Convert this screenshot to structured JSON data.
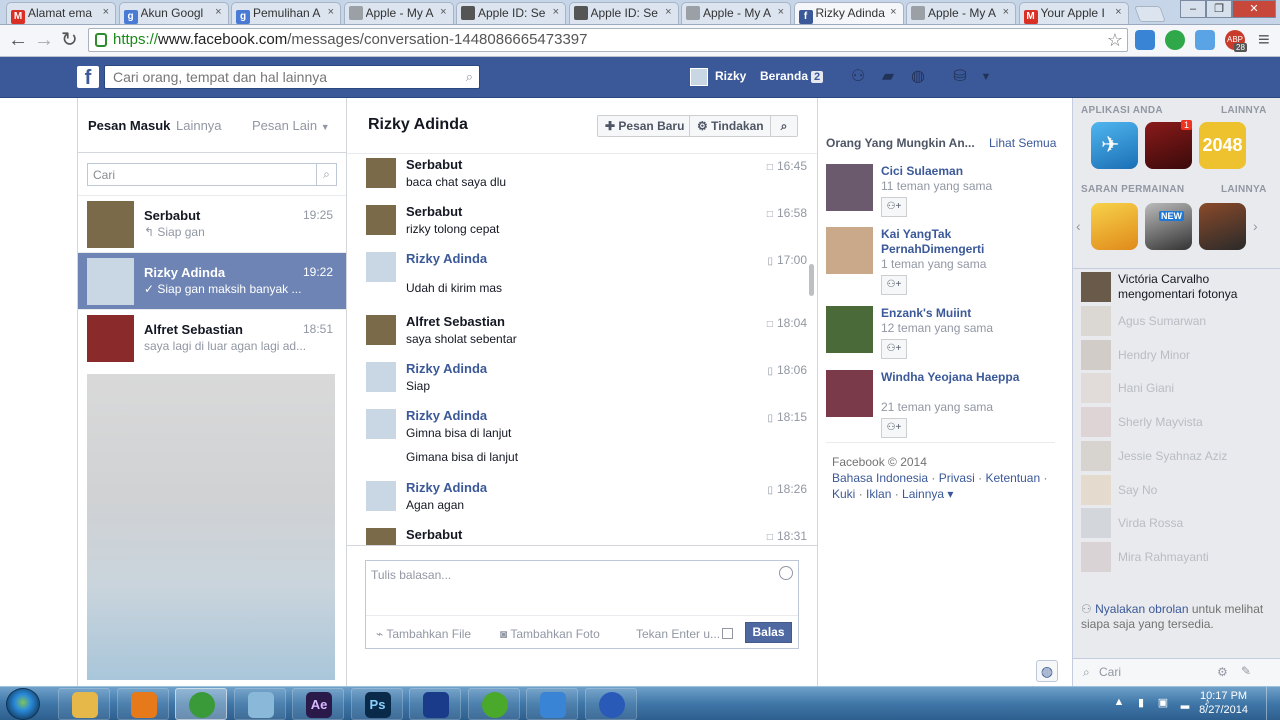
{
  "browser": {
    "tabs": [
      {
        "label": "Alamat ema",
        "favicon": "gmail-icon",
        "color": "#d93025",
        "glyph": "M"
      },
      {
        "label": "Akun Googl",
        "favicon": "google-icon",
        "color": "#4a7bd4",
        "glyph": "g"
      },
      {
        "label": "Pemulihan A",
        "favicon": "google-icon",
        "color": "#4a7bd4",
        "glyph": "g"
      },
      {
        "label": "Apple - My A",
        "favicon": "page-icon",
        "color": "#9aa0a6",
        "glyph": ""
      },
      {
        "label": "Apple ID: Se",
        "favicon": "apple-icon",
        "color": "#555555",
        "glyph": ""
      },
      {
        "label": "Apple ID: Se",
        "favicon": "apple-icon",
        "color": "#555555",
        "glyph": ""
      },
      {
        "label": "Apple - My A",
        "favicon": "page-icon",
        "color": "#9aa0a6",
        "glyph": ""
      },
      {
        "label": "Rizky Adinda",
        "favicon": "facebook-icon",
        "color": "#3b5998",
        "glyph": "f",
        "active": true
      },
      {
        "label": "Apple - My A",
        "favicon": "page-icon",
        "color": "#9aa0a6",
        "glyph": ""
      },
      {
        "label": "Your Apple I",
        "favicon": "gmail-icon",
        "color": "#d93025",
        "glyph": "M"
      }
    ],
    "url_scheme": "https://",
    "url_domain": "www.facebook.com",
    "url_path": "/messages/conversation-1448086665473397",
    "adblock_badge": "28"
  },
  "fb": {
    "search_placeholder": "Cari orang, tempat dan hal lainnya",
    "user_name": "Rizky",
    "home_label": "Beranda",
    "home_count": "2"
  },
  "inbox": {
    "tab_inbox": "Pesan Masuk",
    "tab_more": "Lainnya",
    "tab_other": "Pesan Lain",
    "search_placeholder": "Cari",
    "threads": [
      {
        "name": "Serbabut",
        "time": "19:25",
        "snippet": "↰ Siap gan",
        "selected": false,
        "avatar": "#7a6a4a"
      },
      {
        "name": "Rizky Adinda",
        "time": "19:22",
        "snippet": "✓ Siap gan maksih banyak ...",
        "selected": true,
        "avatar": "#c9d6e4"
      },
      {
        "name": "Alfret Sebastian",
        "time": "18:51",
        "snippet": "saya lagi di luar agan lagi ad...",
        "selected": false,
        "avatar": "#8a2a2a"
      }
    ]
  },
  "conversation": {
    "title": "Rizky Adinda",
    "new_message_label": "Pesan Baru",
    "actions_label": "Tindakan",
    "messages": [
      {
        "author": "Serbabut",
        "text": "baca chat saya dlu",
        "time": "16:45",
        "me": false,
        "device": "□"
      },
      {
        "author": "Serbabut",
        "text": "rizky tolong cepat",
        "time": "16:58",
        "me": false,
        "device": "□"
      },
      {
        "author": "Rizky Adinda",
        "text": "Udah di kirim mas",
        "time": "17:00",
        "me": true,
        "device": "▯"
      },
      {
        "author": "Alfret Sebastian",
        "text": "saya sholat sebentar",
        "time": "18:04",
        "me": false,
        "device": "□"
      },
      {
        "author": "Rizky Adinda",
        "text": "Siap",
        "time": "18:06",
        "me": true,
        "device": "▯"
      },
      {
        "author": "Rizky Adinda",
        "text": "Gimna bisa di lanjut",
        "time": "18:15",
        "me": true,
        "device": "▯"
      },
      {
        "author": "",
        "text": "Gimana bisa di lanjut",
        "time": "",
        "me": true,
        "device": ""
      },
      {
        "author": "Rizky Adinda",
        "text": "Agan agan",
        "time": "18:26",
        "me": true,
        "device": "▯"
      },
      {
        "author": "Serbabut",
        "text": "",
        "time": "18:31",
        "me": false,
        "device": "□"
      }
    ],
    "composer_placeholder": "Tulis balasan...",
    "add_file_label": "Tambahkan File",
    "add_photo_label": "Tambahkan Foto",
    "press_enter_label": "Tekan Enter u...",
    "reply_label": "Balas"
  },
  "pymk": {
    "title": "Orang Yang Mungkin An...",
    "see_all": "Lihat Semua",
    "people": [
      {
        "name": "Cici Sulaeman",
        "mutual": "11 teman yang sama",
        "photo": "#6b5a6e"
      },
      {
        "name": "Kai YangTak PernahDimengerti",
        "mutual": "1 teman yang sama",
        "photo": "#c9a98a"
      },
      {
        "name": "Enzank's Muiint",
        "mutual": "12 teman yang sama",
        "photo": "#4a6a3a"
      },
      {
        "name": "Windha Yeojana Haeppa",
        "mutual": "21 teman yang sama",
        "photo": "#7a3a4a"
      }
    ]
  },
  "footer": {
    "copyright": "Facebook © 2014",
    "links": [
      "Bahasa Indonesia",
      "Privasi",
      "Ketentuan",
      "Kuki",
      "Iklan",
      "Lainnya ▾"
    ]
  },
  "sidebar": {
    "apps_heading": "APLIKASI ANDA",
    "apps_more": "LAINNYA",
    "games_heading": "SARAN PERMAINAN",
    "games_more": "LAINNYA",
    "app_2048": "2048",
    "app_badge": "1",
    "game_badge": "NEW",
    "activity_name": "Victória Carvalho",
    "activity_text": "mengomentari fotonya",
    "friends": [
      "Agus Sumarwan",
      "Hendry Minor",
      "Hani Giani",
      "Sherly Mayvista",
      "Jessie Syahnaz Aziz",
      "Say No",
      "Virda Rossa",
      "Mira Rahmayanti"
    ],
    "chat_on_link": "Nyalakan obrolan",
    "chat_on_rest": "untuk melihat siapa saja yang tersedia.",
    "search_placeholder": "Cari"
  },
  "taskbar": {
    "time": "10:17 PM",
    "date": "8/27/2014",
    "apps": [
      "explorer-icon",
      "media-player-icon",
      "chrome-icon",
      "notepad-icon",
      "after-effects-icon",
      "photoshop-icon",
      "metro-icon",
      "utorrent-icon",
      "cloud-icon",
      "itunes-icon"
    ],
    "ae_label": "Ae",
    "ps_label": "Ps"
  }
}
